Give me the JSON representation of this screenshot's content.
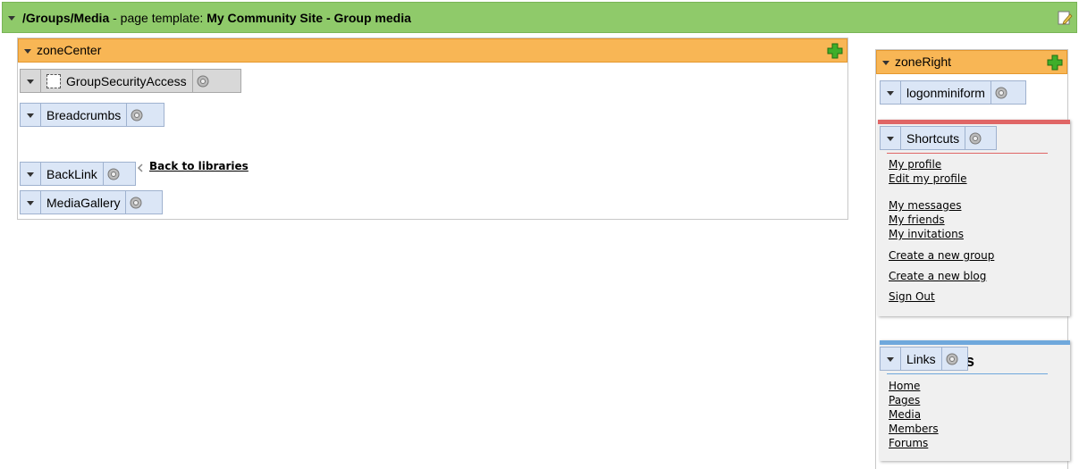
{
  "header": {
    "path": "/Groups/Media",
    "separator": " - page template: ",
    "template_name": "My Community Site - Group media"
  },
  "zone_center": {
    "label": "zoneCenter",
    "webparts": {
      "group_security": "GroupSecurityAccess",
      "breadcrumbs": "Breadcrumbs",
      "backlink": "BackLink",
      "back_text": "Back to libraries",
      "media_gallery": "MediaGallery"
    }
  },
  "zone_right": {
    "label": "zoneRight",
    "logon": "logonminiform",
    "shortcuts": {
      "label": "Shortcuts",
      "items": [
        "My profile",
        "Edit my profile",
        "My messages",
        "My friends",
        "My invitations",
        "Create a new group",
        "Create a new blog",
        "Sign Out"
      ]
    },
    "links": {
      "label": "Links",
      "heading_fragment": "ks",
      "items": [
        "Home",
        "Pages",
        "Media",
        "Members",
        "Forums"
      ]
    }
  },
  "colors": {
    "header_green": "#8fca6a",
    "zone_orange": "#f8b655",
    "webpart_blue": "#dbe6f6",
    "shortcuts_accent": "#e06666",
    "links_accent": "#6fa8dc"
  },
  "icons": [
    "dropdown-arrow-icon",
    "edit-icon",
    "plus-icon",
    "gear-icon",
    "checkbox-icon"
  ]
}
